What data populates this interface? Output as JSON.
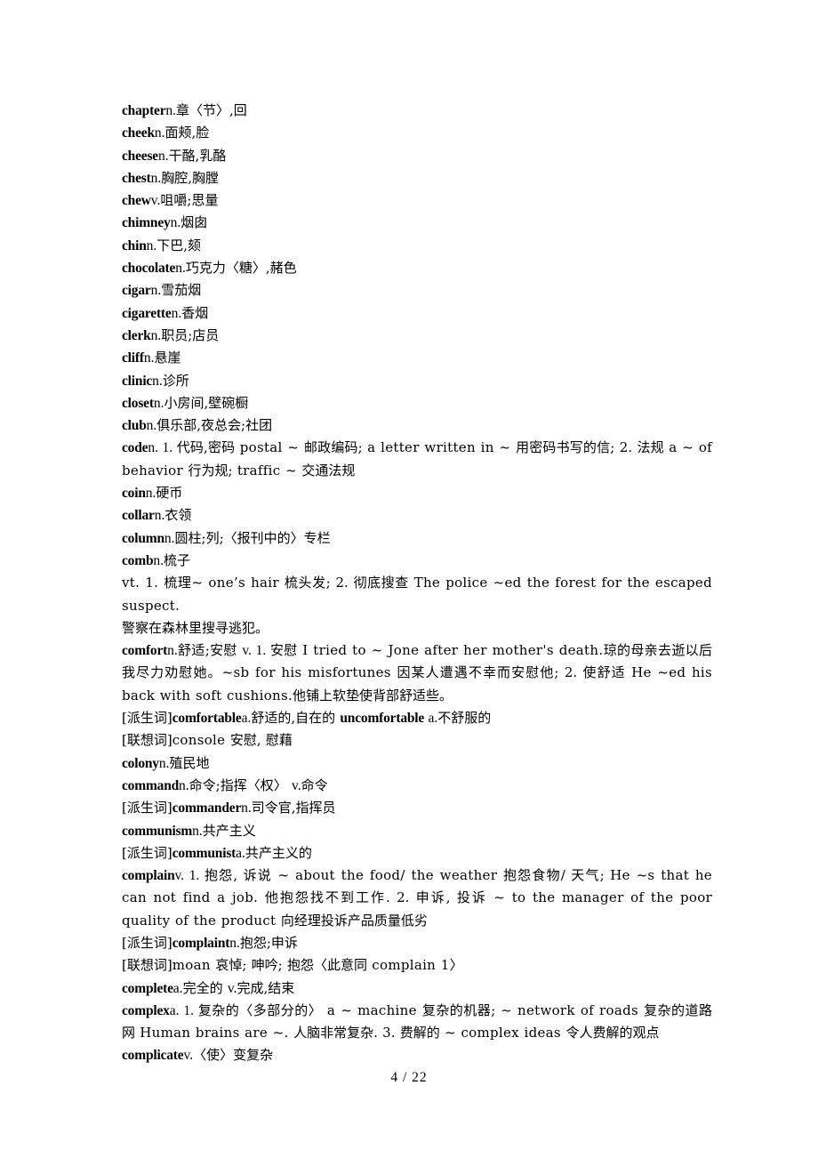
{
  "document": {
    "footer": "4 / 22"
  },
  "entries": [
    {
      "id": "chapter",
      "wrap": false,
      "parts": [
        {
          "t": "hw",
          "v": "chapter"
        },
        {
          "t": "pos",
          "v": "n."
        },
        {
          "t": "cn",
          "v": "章〈节〉,回"
        }
      ]
    },
    {
      "id": "cheek",
      "wrap": false,
      "parts": [
        {
          "t": "hw",
          "v": "cheek"
        },
        {
          "t": "pos",
          "v": "n."
        },
        {
          "t": "cn",
          "v": "面颊,脸"
        }
      ]
    },
    {
      "id": "cheese",
      "wrap": false,
      "parts": [
        {
          "t": "hw",
          "v": "cheese"
        },
        {
          "t": "pos",
          "v": "n."
        },
        {
          "t": "cn",
          "v": "干酪,乳酪"
        }
      ]
    },
    {
      "id": "chest",
      "wrap": false,
      "parts": [
        {
          "t": "hw",
          "v": "chest"
        },
        {
          "t": "pos",
          "v": "n."
        },
        {
          "t": "cn",
          "v": "胸腔,胸膛"
        }
      ]
    },
    {
      "id": "chew",
      "wrap": false,
      "parts": [
        {
          "t": "hw",
          "v": "chew"
        },
        {
          "t": "pos",
          "v": "v."
        },
        {
          "t": "cn",
          "v": "咀嚼;思量"
        }
      ]
    },
    {
      "id": "chimney",
      "wrap": false,
      "parts": [
        {
          "t": "hw",
          "v": "chimney"
        },
        {
          "t": "pos",
          "v": "n."
        },
        {
          "t": "cn",
          "v": "烟囱"
        }
      ]
    },
    {
      "id": "chin",
      "wrap": false,
      "parts": [
        {
          "t": "hw",
          "v": "chin"
        },
        {
          "t": "pos",
          "v": "n."
        },
        {
          "t": "cn",
          "v": "下巴,颏"
        }
      ]
    },
    {
      "id": "chocolate",
      "wrap": false,
      "parts": [
        {
          "t": "hw",
          "v": "chocolate"
        },
        {
          "t": "pos",
          "v": "n."
        },
        {
          "t": "cn",
          "v": "巧克力〈糖〉,赭色"
        }
      ]
    },
    {
      "id": "cigar",
      "wrap": false,
      "parts": [
        {
          "t": "hw",
          "v": "cigar"
        },
        {
          "t": "pos",
          "v": "n."
        },
        {
          "t": "cn",
          "v": "雪茄烟"
        }
      ]
    },
    {
      "id": "cigarette",
      "wrap": false,
      "parts": [
        {
          "t": "hw",
          "v": "cigarette"
        },
        {
          "t": "pos",
          "v": "n."
        },
        {
          "t": "cn",
          "v": "香烟"
        }
      ]
    },
    {
      "id": "clerk",
      "wrap": false,
      "parts": [
        {
          "t": "hw",
          "v": "clerk"
        },
        {
          "t": "pos",
          "v": "n."
        },
        {
          "t": "cn",
          "v": "职员;店员"
        }
      ]
    },
    {
      "id": "cliff",
      "wrap": false,
      "parts": [
        {
          "t": "hw",
          "v": "cliff"
        },
        {
          "t": "pos",
          "v": "n."
        },
        {
          "t": "cn",
          "v": "悬崖"
        }
      ]
    },
    {
      "id": "clinic",
      "wrap": false,
      "parts": [
        {
          "t": "hw",
          "v": "clinic"
        },
        {
          "t": "pos",
          "v": "n."
        },
        {
          "t": "cn",
          "v": "诊所"
        }
      ]
    },
    {
      "id": "closet",
      "wrap": false,
      "parts": [
        {
          "t": "hw",
          "v": "closet"
        },
        {
          "t": "pos",
          "v": "n."
        },
        {
          "t": "cn",
          "v": "小房间,壁碗橱"
        }
      ]
    },
    {
      "id": "club",
      "wrap": false,
      "parts": [
        {
          "t": "hw",
          "v": "club"
        },
        {
          "t": "pos",
          "v": "n."
        },
        {
          "t": "cn",
          "v": "俱乐部,夜总会;社团"
        }
      ]
    },
    {
      "id": "code",
      "wrap": true,
      "parts": [
        {
          "t": "hw",
          "v": "code"
        },
        {
          "t": "pos",
          "v": "n. 1. "
        },
        {
          "t": "cn",
          "v": "代码,密码 "
        },
        {
          "t": "en",
          "v": "postal ~ "
        },
        {
          "t": "cn",
          "v": "邮政编码; "
        },
        {
          "t": "en",
          "v": "a letter written in ~ "
        },
        {
          "t": "cn",
          "v": "用密码书写的信; 2. 法规 "
        },
        {
          "t": "en",
          "v": "a ~ of behavior "
        },
        {
          "t": "cn",
          "v": "行为规; "
        },
        {
          "t": "en",
          "v": "traffic ~ "
        },
        {
          "t": "cn",
          "v": "交通法规"
        }
      ]
    },
    {
      "id": "coin",
      "wrap": false,
      "parts": [
        {
          "t": "hw",
          "v": "coin"
        },
        {
          "t": "pos",
          "v": "n."
        },
        {
          "t": "cn",
          "v": "硬币"
        }
      ]
    },
    {
      "id": "collar",
      "wrap": false,
      "parts": [
        {
          "t": "hw",
          "v": "collar"
        },
        {
          "t": "pos",
          "v": "n."
        },
        {
          "t": "cn",
          "v": "衣领"
        }
      ]
    },
    {
      "id": "column",
      "wrap": false,
      "parts": [
        {
          "t": "hw",
          "v": "column"
        },
        {
          "t": "pos",
          "v": "n."
        },
        {
          "t": "cn",
          "v": "圆柱;列;〈报刊中的〉专栏"
        }
      ]
    },
    {
      "id": "comb",
      "wrap": false,
      "parts": [
        {
          "t": "hw",
          "v": "comb"
        },
        {
          "t": "pos",
          "v": "n."
        },
        {
          "t": "cn",
          "v": "梳子"
        }
      ]
    },
    {
      "id": "comb-vt",
      "wrap": true,
      "parts": [
        {
          "t": "en",
          "v": "vt. 1. "
        },
        {
          "t": "cn",
          "v": "梳理"
        },
        {
          "t": "en",
          "v": "~ one’s hair "
        },
        {
          "t": "cn",
          "v": "梳头发; 2. 彻底搜查 "
        },
        {
          "t": "en",
          "v": "The police ~ed the forest for the escaped suspect."
        }
      ]
    },
    {
      "id": "comb-vt-cn",
      "wrap": false,
      "parts": [
        {
          "t": "cn",
          "v": "警察在森林里搜寻逃犯。"
        }
      ]
    },
    {
      "id": "comfort",
      "wrap": true,
      "parts": [
        {
          "t": "hw",
          "v": "comfort"
        },
        {
          "t": "pos",
          "v": "n."
        },
        {
          "t": "cn",
          "v": "舒适;安慰 "
        },
        {
          "t": "pos",
          "v": "v. 1. "
        },
        {
          "t": "cn",
          "v": "安慰 "
        },
        {
          "t": "en",
          "v": "I tried to ~ Jone after her mother's death."
        },
        {
          "t": "cn",
          "v": "琼的母亲去逝以后我尽力劝慰她。"
        },
        {
          "t": "en",
          "v": "~sb for his misfortunes "
        },
        {
          "t": "cn",
          "v": "因某人遭遇不幸而安慰他; 2. 使舒适 "
        },
        {
          "t": "en",
          "v": "He ~ed his back with soft cushions."
        },
        {
          "t": "cn",
          "v": "他铺上软垫使背部舒适些。"
        }
      ]
    },
    {
      "id": "comfort-derived",
      "wrap": false,
      "parts": [
        {
          "t": "tag",
          "v": "[派生词]"
        },
        {
          "t": "hw",
          "v": "comfortable"
        },
        {
          "t": "pos",
          "v": "a."
        },
        {
          "t": "cn",
          "v": "舒适的,自在的 "
        },
        {
          "t": "hw",
          "v": "uncomfortable"
        },
        {
          "t": "pos",
          "v": " a."
        },
        {
          "t": "cn",
          "v": "不舒服的"
        }
      ]
    },
    {
      "id": "comfort-assoc",
      "wrap": false,
      "parts": [
        {
          "t": "tag",
          "v": "[联想词]"
        },
        {
          "t": "en",
          "v": "console "
        },
        {
          "t": "cn",
          "v": "安慰, 慰藉"
        }
      ]
    },
    {
      "id": "colony",
      "wrap": false,
      "parts": [
        {
          "t": "hw",
          "v": "colony"
        },
        {
          "t": "pos",
          "v": "n."
        },
        {
          "t": "cn",
          "v": "殖民地"
        }
      ]
    },
    {
      "id": "command",
      "wrap": false,
      "parts": [
        {
          "t": "hw",
          "v": "command"
        },
        {
          "t": "pos",
          "v": "n."
        },
        {
          "t": "cn",
          "v": "命令;指挥〈权〉 "
        },
        {
          "t": "pos",
          "v": "v."
        },
        {
          "t": "cn",
          "v": "命令"
        }
      ]
    },
    {
      "id": "commander",
      "wrap": false,
      "parts": [
        {
          "t": "tag",
          "v": "[派生词]"
        },
        {
          "t": "hw",
          "v": "commander"
        },
        {
          "t": "pos",
          "v": "n."
        },
        {
          "t": "cn",
          "v": "司令官,指挥员"
        }
      ]
    },
    {
      "id": "communism",
      "wrap": false,
      "parts": [
        {
          "t": "hw",
          "v": "communism"
        },
        {
          "t": "pos",
          "v": "n."
        },
        {
          "t": "cn",
          "v": "共产主义"
        }
      ]
    },
    {
      "id": "communist",
      "wrap": false,
      "parts": [
        {
          "t": "tag",
          "v": "[派生词]"
        },
        {
          "t": "hw",
          "v": "communist"
        },
        {
          "t": "pos",
          "v": "a."
        },
        {
          "t": "cn",
          "v": "共产主义的"
        }
      ]
    },
    {
      "id": "complain",
      "wrap": true,
      "parts": [
        {
          "t": "hw",
          "v": "complain"
        },
        {
          "t": "pos",
          "v": "v. 1. "
        },
        {
          "t": "cn",
          "v": "抱怨, 诉说 "
        },
        {
          "t": "en",
          "v": "~ about the food/ the weather "
        },
        {
          "t": "cn",
          "v": "抱怨食物/ 天气; "
        },
        {
          "t": "en",
          "v": "He ~s that he can not find a job. "
        },
        {
          "t": "cn",
          "v": "他抱怨找不到工作. 2. 申诉, 投诉 "
        },
        {
          "t": "en",
          "v": "~ to the manager of the poor quality of the product "
        },
        {
          "t": "cn",
          "v": "向经理投诉产品质量低劣"
        }
      ]
    },
    {
      "id": "complaint",
      "wrap": false,
      "parts": [
        {
          "t": "tag",
          "v": "[派生词]"
        },
        {
          "t": "hw",
          "v": "complaint"
        },
        {
          "t": "pos",
          "v": "n."
        },
        {
          "t": "cn",
          "v": "抱怨;申诉"
        }
      ]
    },
    {
      "id": "moan",
      "wrap": false,
      "parts": [
        {
          "t": "tag",
          "v": "[联想词]"
        },
        {
          "t": "en",
          "v": "moan "
        },
        {
          "t": "cn",
          "v": "哀悼; 呻吟; 抱怨〈此意同 "
        },
        {
          "t": "en",
          "v": "complain 1"
        },
        {
          "t": "cn",
          "v": "〉"
        }
      ]
    },
    {
      "id": "complete",
      "wrap": false,
      "parts": [
        {
          "t": "hw",
          "v": "complete"
        },
        {
          "t": "pos",
          "v": "a."
        },
        {
          "t": "cn",
          "v": "完全的 "
        },
        {
          "t": "pos",
          "v": "v."
        },
        {
          "t": "cn",
          "v": "完成,结束"
        }
      ]
    },
    {
      "id": "complex",
      "wrap": true,
      "parts": [
        {
          "t": "hw",
          "v": "complex"
        },
        {
          "t": "pos",
          "v": "a. 1. "
        },
        {
          "t": "cn",
          "v": "复杂的〈多部分的〉 "
        },
        {
          "t": "en",
          "v": "a ~ machine "
        },
        {
          "t": "cn",
          "v": "复杂的机器; "
        },
        {
          "t": "en",
          "v": "~ network of roads "
        },
        {
          "t": "cn",
          "v": "复杂的道路网 "
        },
        {
          "t": "en",
          "v": "Human brains are ~. "
        },
        {
          "t": "cn",
          "v": "人脑非常复杂. 3. 费解的 "
        },
        {
          "t": "en",
          "v": "~ complex ideas "
        },
        {
          "t": "cn",
          "v": "令人费解的观点"
        }
      ]
    },
    {
      "id": "complicate",
      "wrap": false,
      "parts": [
        {
          "t": "hw",
          "v": "complicate"
        },
        {
          "t": "pos",
          "v": "v."
        },
        {
          "t": "cn",
          "v": "〈使〉变复杂"
        }
      ]
    }
  ]
}
